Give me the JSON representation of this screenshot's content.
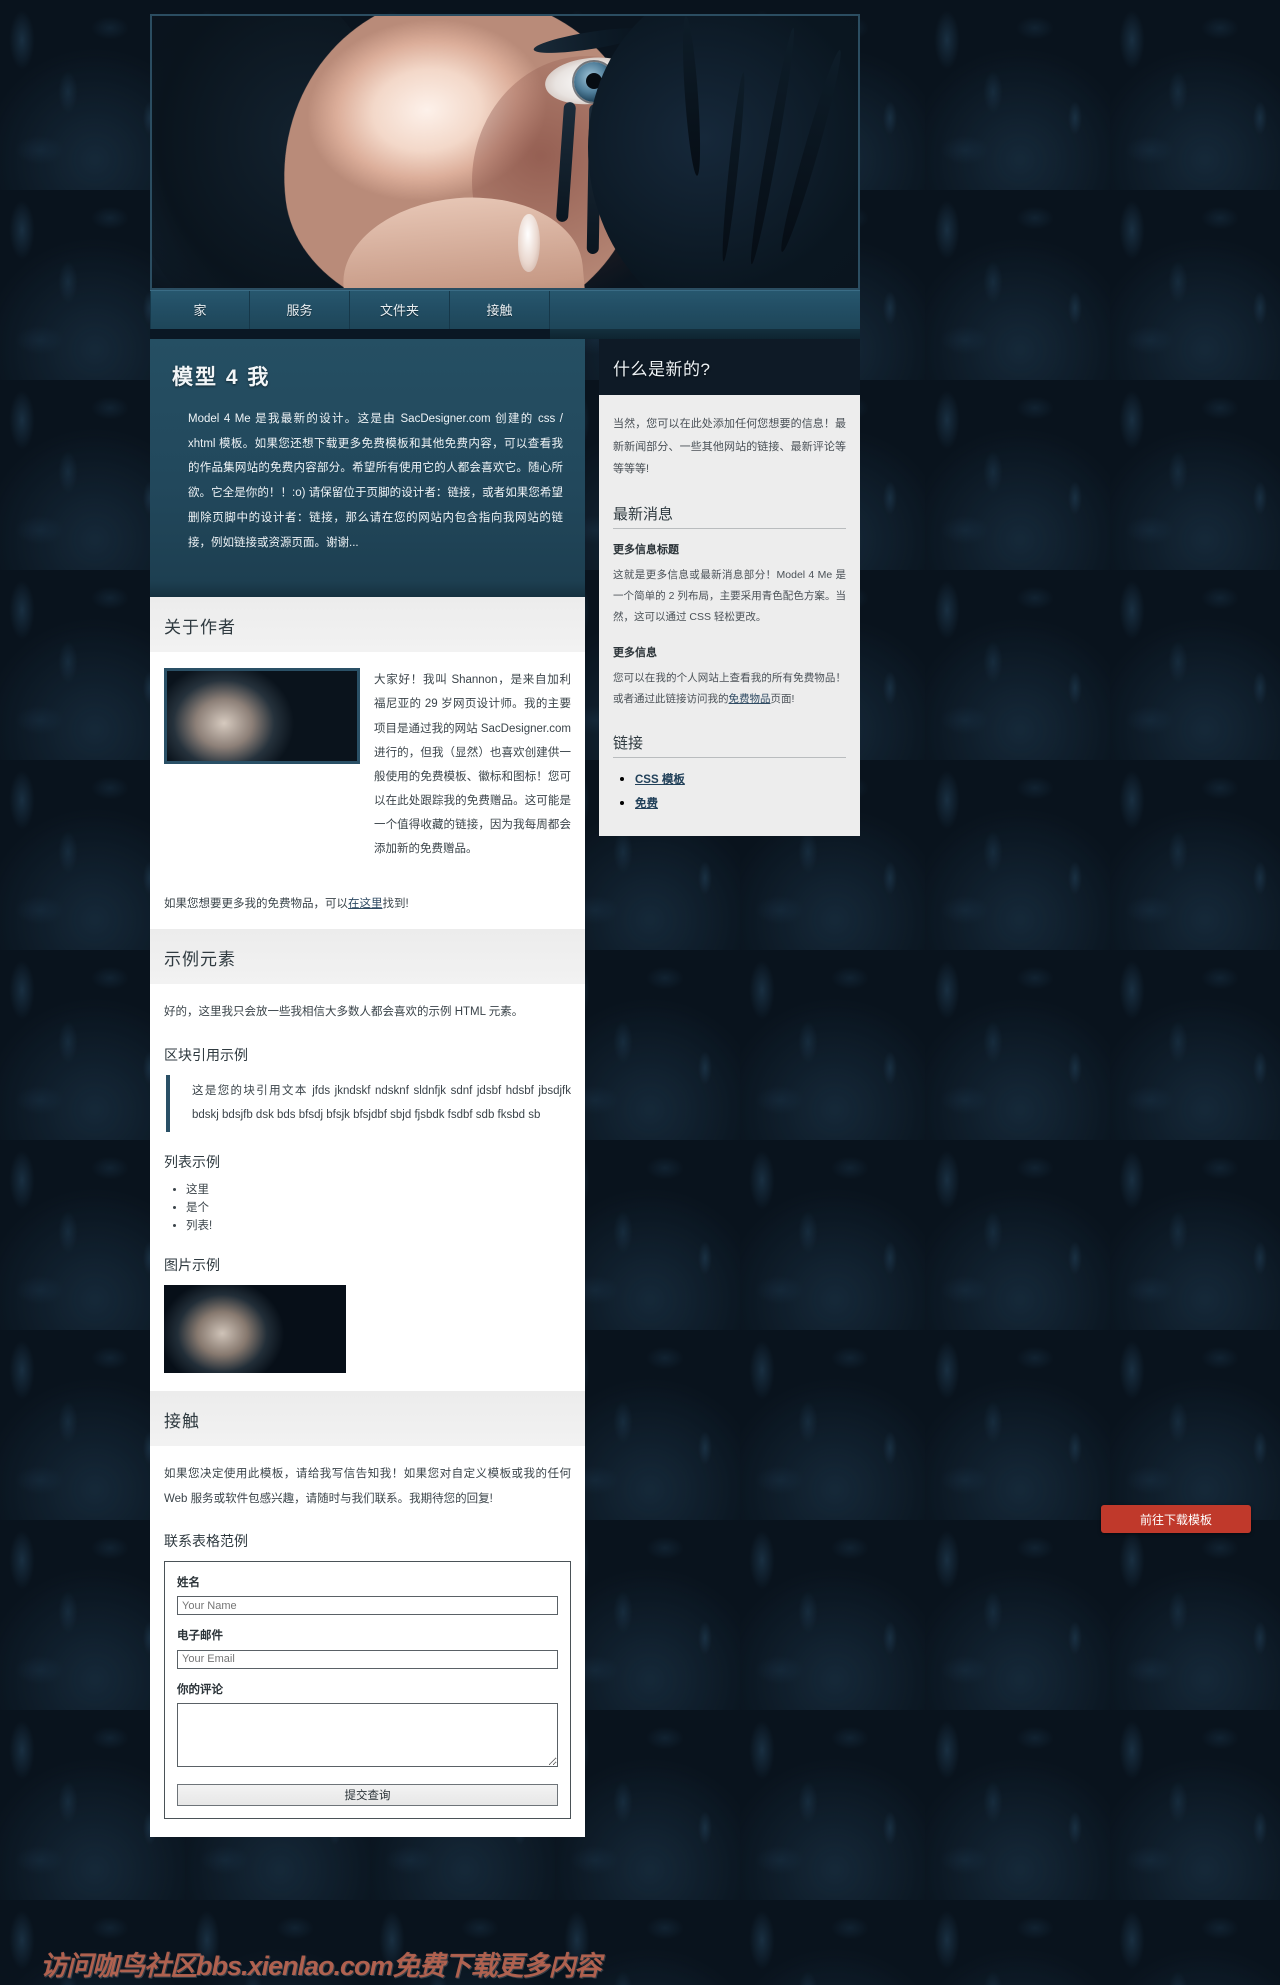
{
  "site": {
    "hero_alt": "model-portrait-banner"
  },
  "nav": {
    "items": [
      {
        "label": "家"
      },
      {
        "label": "服务"
      },
      {
        "label": "文件夹"
      },
      {
        "label": "接触"
      }
    ]
  },
  "intro": {
    "title": "模型 4 我",
    "body": "Model 4 Me 是我最新的设计。这是由 SacDesigner.com 创建的 css / xhtml 模板。如果您还想下载更多免费模板和其他免费内容，可以查看我的作品集网站的免费内容部分。希望所有使用它的人都会喜欢它。随心所欲。它全是你的！！:o) 请保留位于页脚的设计者：链接，或者如果您希望删除页脚中的设计者：链接，那么请在您的网站内包含指向我网站的链接，例如链接或资源页面。谢谢..."
  },
  "about": {
    "heading": "关于作者",
    "photo_alt": "author-portrait",
    "body": "大家好！我叫 Shannon，是来自加利福尼亚的 29 岁网页设计师。我的主要项目是通过我的网站 SacDesigner.com 进行的，但我（显然）也喜欢创建供一般使用的免费模板、徽标和图标！您可以在此处跟踪我的免费赠品。这可能是一个值得收藏的链接，因为我每周都会添加新的免费赠品。",
    "more_prefix": "如果您想要更多我的免费物品，可以",
    "more_link": "在这里",
    "more_suffix": "找到!"
  },
  "samples": {
    "heading": "示例元素",
    "intro": "好的，这里我只会放一些我相信大多数人都会喜欢的示例 HTML 元素。",
    "blockquote_title": "区块引用示例",
    "blockquote_text": "这是您的块引用文本 jfds jkndskf ndsknf sldnfjk sdnf jdsbf hdsbf jbsdjfk bdskj bdsjfb dsk bds bfsdj bfsjk bfsjdbf sbjd fjsbdk fsdbf sdb fksbd sb",
    "list_title": "列表示例",
    "list_items": [
      "这里",
      "是个",
      "列表!"
    ],
    "image_title": "图片示例",
    "image_alt": "sample-portrait"
  },
  "contact": {
    "heading": "接触",
    "body": "如果您决定使用此模板，请给我写信告知我！如果您对自定义模板或我的任何 Web 服务或软件包感兴趣，请随时与我们联系。我期待您的回复!",
    "form_title": "联系表格范例",
    "fields": {
      "name_label": "姓名",
      "name_placeholder": "Your Name",
      "email_label": "电子邮件",
      "email_placeholder": "Your Email",
      "comment_label": "你的评论",
      "comment_placeholder": ""
    },
    "submit_label": "提交查询"
  },
  "sidebar": {
    "title": "什么是新的?",
    "intro": "当然，您可以在此处添加任何您想要的信息！最新新闻部分、一些其他网站的链接、最新评论等等等等!",
    "news_title": "最新消息",
    "news": [
      {
        "title": "更多信息标题",
        "body": "这就是更多信息或最新消息部分！Model 4 Me 是一个简单的 2 列布局，主要采用青色配色方案。当然，这可以通过 CSS 轻松更改。"
      },
      {
        "title": "更多信息",
        "body_prefix": "您可以在我的个人网站上查看我的所有免费物品！或者通过此链接访问我的",
        "body_link": "免费物品",
        "body_suffix": "页面!"
      }
    ],
    "links_title": "链接",
    "links": [
      {
        "label": "CSS 模板"
      },
      {
        "label": "免费"
      }
    ]
  },
  "overlay": {
    "watermark": "访问咖鸟社区bbs.xienlao.com免费下载更多内容",
    "download_button": "前往下载模板"
  },
  "colors": {
    "accent_teal": "#2a5066",
    "nav_bg": "#22485c",
    "sidebar_head": "#0e1a26",
    "download_red": "#c0392b",
    "watermark_red": "#c16852"
  }
}
